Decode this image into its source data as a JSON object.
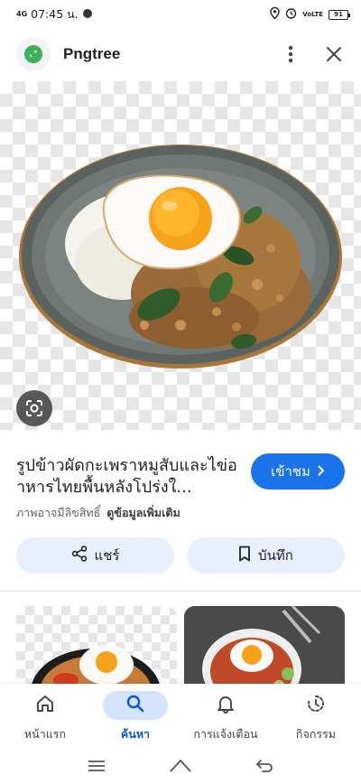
{
  "status_bar": {
    "signal": "4G",
    "time": "07:45 น.",
    "network": "VoLTE",
    "battery": "91"
  },
  "header": {
    "site_name": "Pngtree",
    "logo_icon": "pngtree-logo-icon",
    "more_icon": "more-vert-icon",
    "close_icon": "close-icon"
  },
  "image": {
    "lens_icon": "lens-icon"
  },
  "result": {
    "title": "รูปข้าวผัดกะเพราหมูสับและไข่อาหารไทยพื้นหลังโปร่งใ...",
    "visit_label": "เข้าชม",
    "copyright_text": "ภาพอาจมีลิขสิทธิ์",
    "more_info": "ดูข้อมูลเพิ่มเติม"
  },
  "actions": {
    "share_label": "แชร์",
    "save_label": "บันทึก"
  },
  "bottom_nav": {
    "items": [
      {
        "label": "หน้าแรก",
        "icon": "home-icon"
      },
      {
        "label": "ค้นหา",
        "icon": "search-icon",
        "active": true
      },
      {
        "label": "การแจ้งเตือน",
        "icon": "bell-icon"
      },
      {
        "label": "กิจกรรม",
        "icon": "activity-icon"
      }
    ]
  },
  "colors": {
    "accent": "#1a73e8",
    "pill_bg": "#e8f0fe",
    "active_nav_bg": "#d3e3fd",
    "active_nav_text": "#0b57d0"
  }
}
